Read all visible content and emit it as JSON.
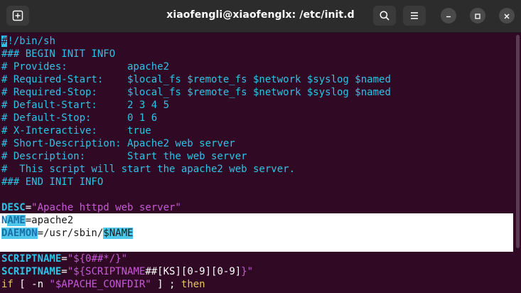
{
  "window": {
    "title": "xiaofengli@xiaofenglx: /etc/init.d"
  },
  "icons": [
    "new-tab-icon",
    "search-icon",
    "hamburger-menu-icon",
    "minimize-icon",
    "maximize-icon",
    "close-icon"
  ],
  "colors": {
    "background": "#300a24",
    "comment": "#2ec3e6",
    "string": "#c65ad8",
    "text": "#ffffff",
    "keyword": "#e9c46a",
    "selection": "#ffffff"
  },
  "editor": {
    "lines": {
      "l1_cursor": "#",
      "l1_rest": "!/bin/sh",
      "l2": "### BEGIN INIT INFO",
      "l3": "# Provides:          apache2",
      "l4": "# Required-Start:    $local_fs $remote_fs $network $syslog $named",
      "l5": "# Required-Stop:     $local_fs $remote_fs $network $syslog $named",
      "l6": "# Default-Start:     2 3 4 5",
      "l7": "# Default-Stop:      0 1 6",
      "l8": "# X-Interactive:     true",
      "l9": "# Short-Description: Apache2 web server",
      "l10": "# Description:       Start the web server",
      "l11": "#  This script will start the apache2 web server.",
      "l12": "### END INIT INFO",
      "desc_key": "DESC",
      "desc_eq": "=",
      "desc_val": "\"Apache httpd web server\"",
      "name_n": "N",
      "name_ame": "AME",
      "name_rest": "=apache2",
      "daemon_key": "DAEMON",
      "daemon_mid": "=/usr/sbin/",
      "daemon_var": "$NAME",
      "s1_key": "SCRIPTNAME",
      "s1_eq": "=",
      "s1_val": "\"${0##*/}\"",
      "s2_key": "SCRIPTNAME",
      "s2_eq": "=",
      "s2_q1": "\"${",
      "s2_var": "SCRIPTNAME",
      "s2_ops": "##[KS][0-9][0-9]",
      "s2_q2": "}\"",
      "if_kw": "if",
      "if_mid": " [ -n ",
      "if_str": "\"$APACHE_CONFDIR\"",
      "if_end": " ] ; ",
      "then_kw": "then"
    }
  }
}
